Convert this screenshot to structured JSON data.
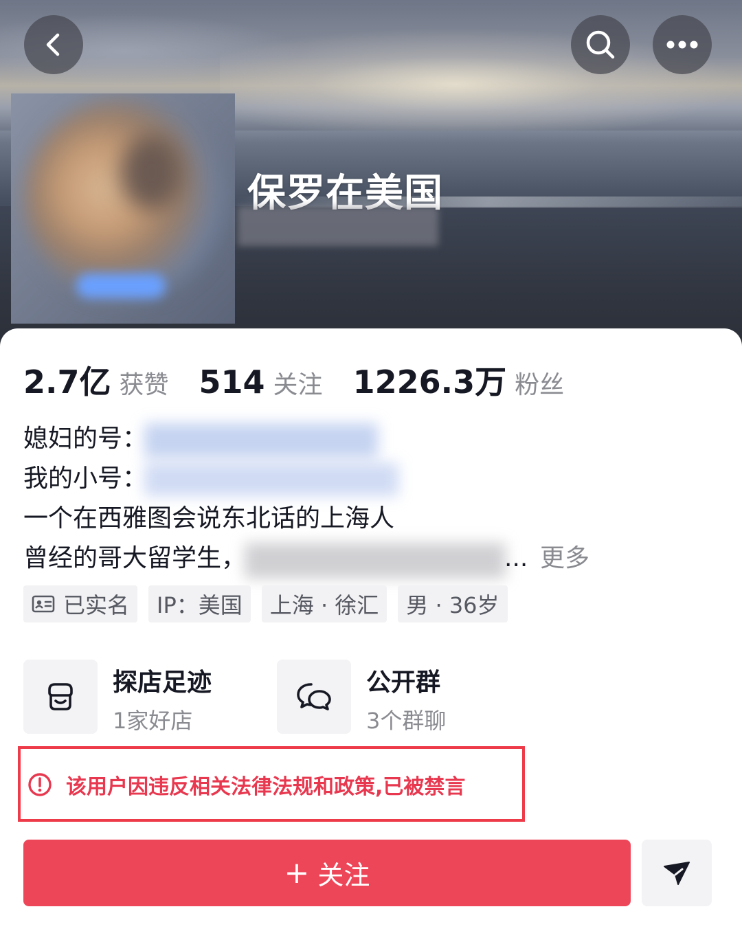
{
  "header": {
    "nickname": "保罗在美国"
  },
  "icons": {
    "back": "chevron-left-icon",
    "search": "search-icon",
    "more": "more-dots-icon",
    "id_card": "id-card-icon",
    "store": "store-icon",
    "group_chat": "chat-bubbles-icon",
    "alert": "alert-circle-icon",
    "send": "send-icon"
  },
  "stats": [
    {
      "value": "2.7亿",
      "label": "获赞"
    },
    {
      "value": "514",
      "label": "关注"
    },
    {
      "value": "1226.3万",
      "label": "粉丝"
    }
  ],
  "bio": {
    "line1_prefix": "媳妇的号：",
    "line2_prefix": "我的小号：",
    "line3": "一个在西雅图会说东北话的上海人",
    "line4_prefix": "曾经的哥大留学生，",
    "ellipsis": "...",
    "more": "更多"
  },
  "tags": {
    "verified": "已实名",
    "ip": "IP：美国",
    "location": "上海 · 徐汇",
    "gender_age": "男 · 36岁"
  },
  "entries": {
    "store_title": "探店足迹",
    "store_sub": "1家好店",
    "group_title": "公开群",
    "group_sub": "3个群聊"
  },
  "banned_notice": "该用户因违反相关法律法规和政策,已被禁言",
  "follow_button": {
    "plus": "+",
    "label": "关注"
  },
  "colors": {
    "accent": "#ee4659",
    "warning": "#e8384f",
    "secondary_text": "#8a8b91"
  }
}
